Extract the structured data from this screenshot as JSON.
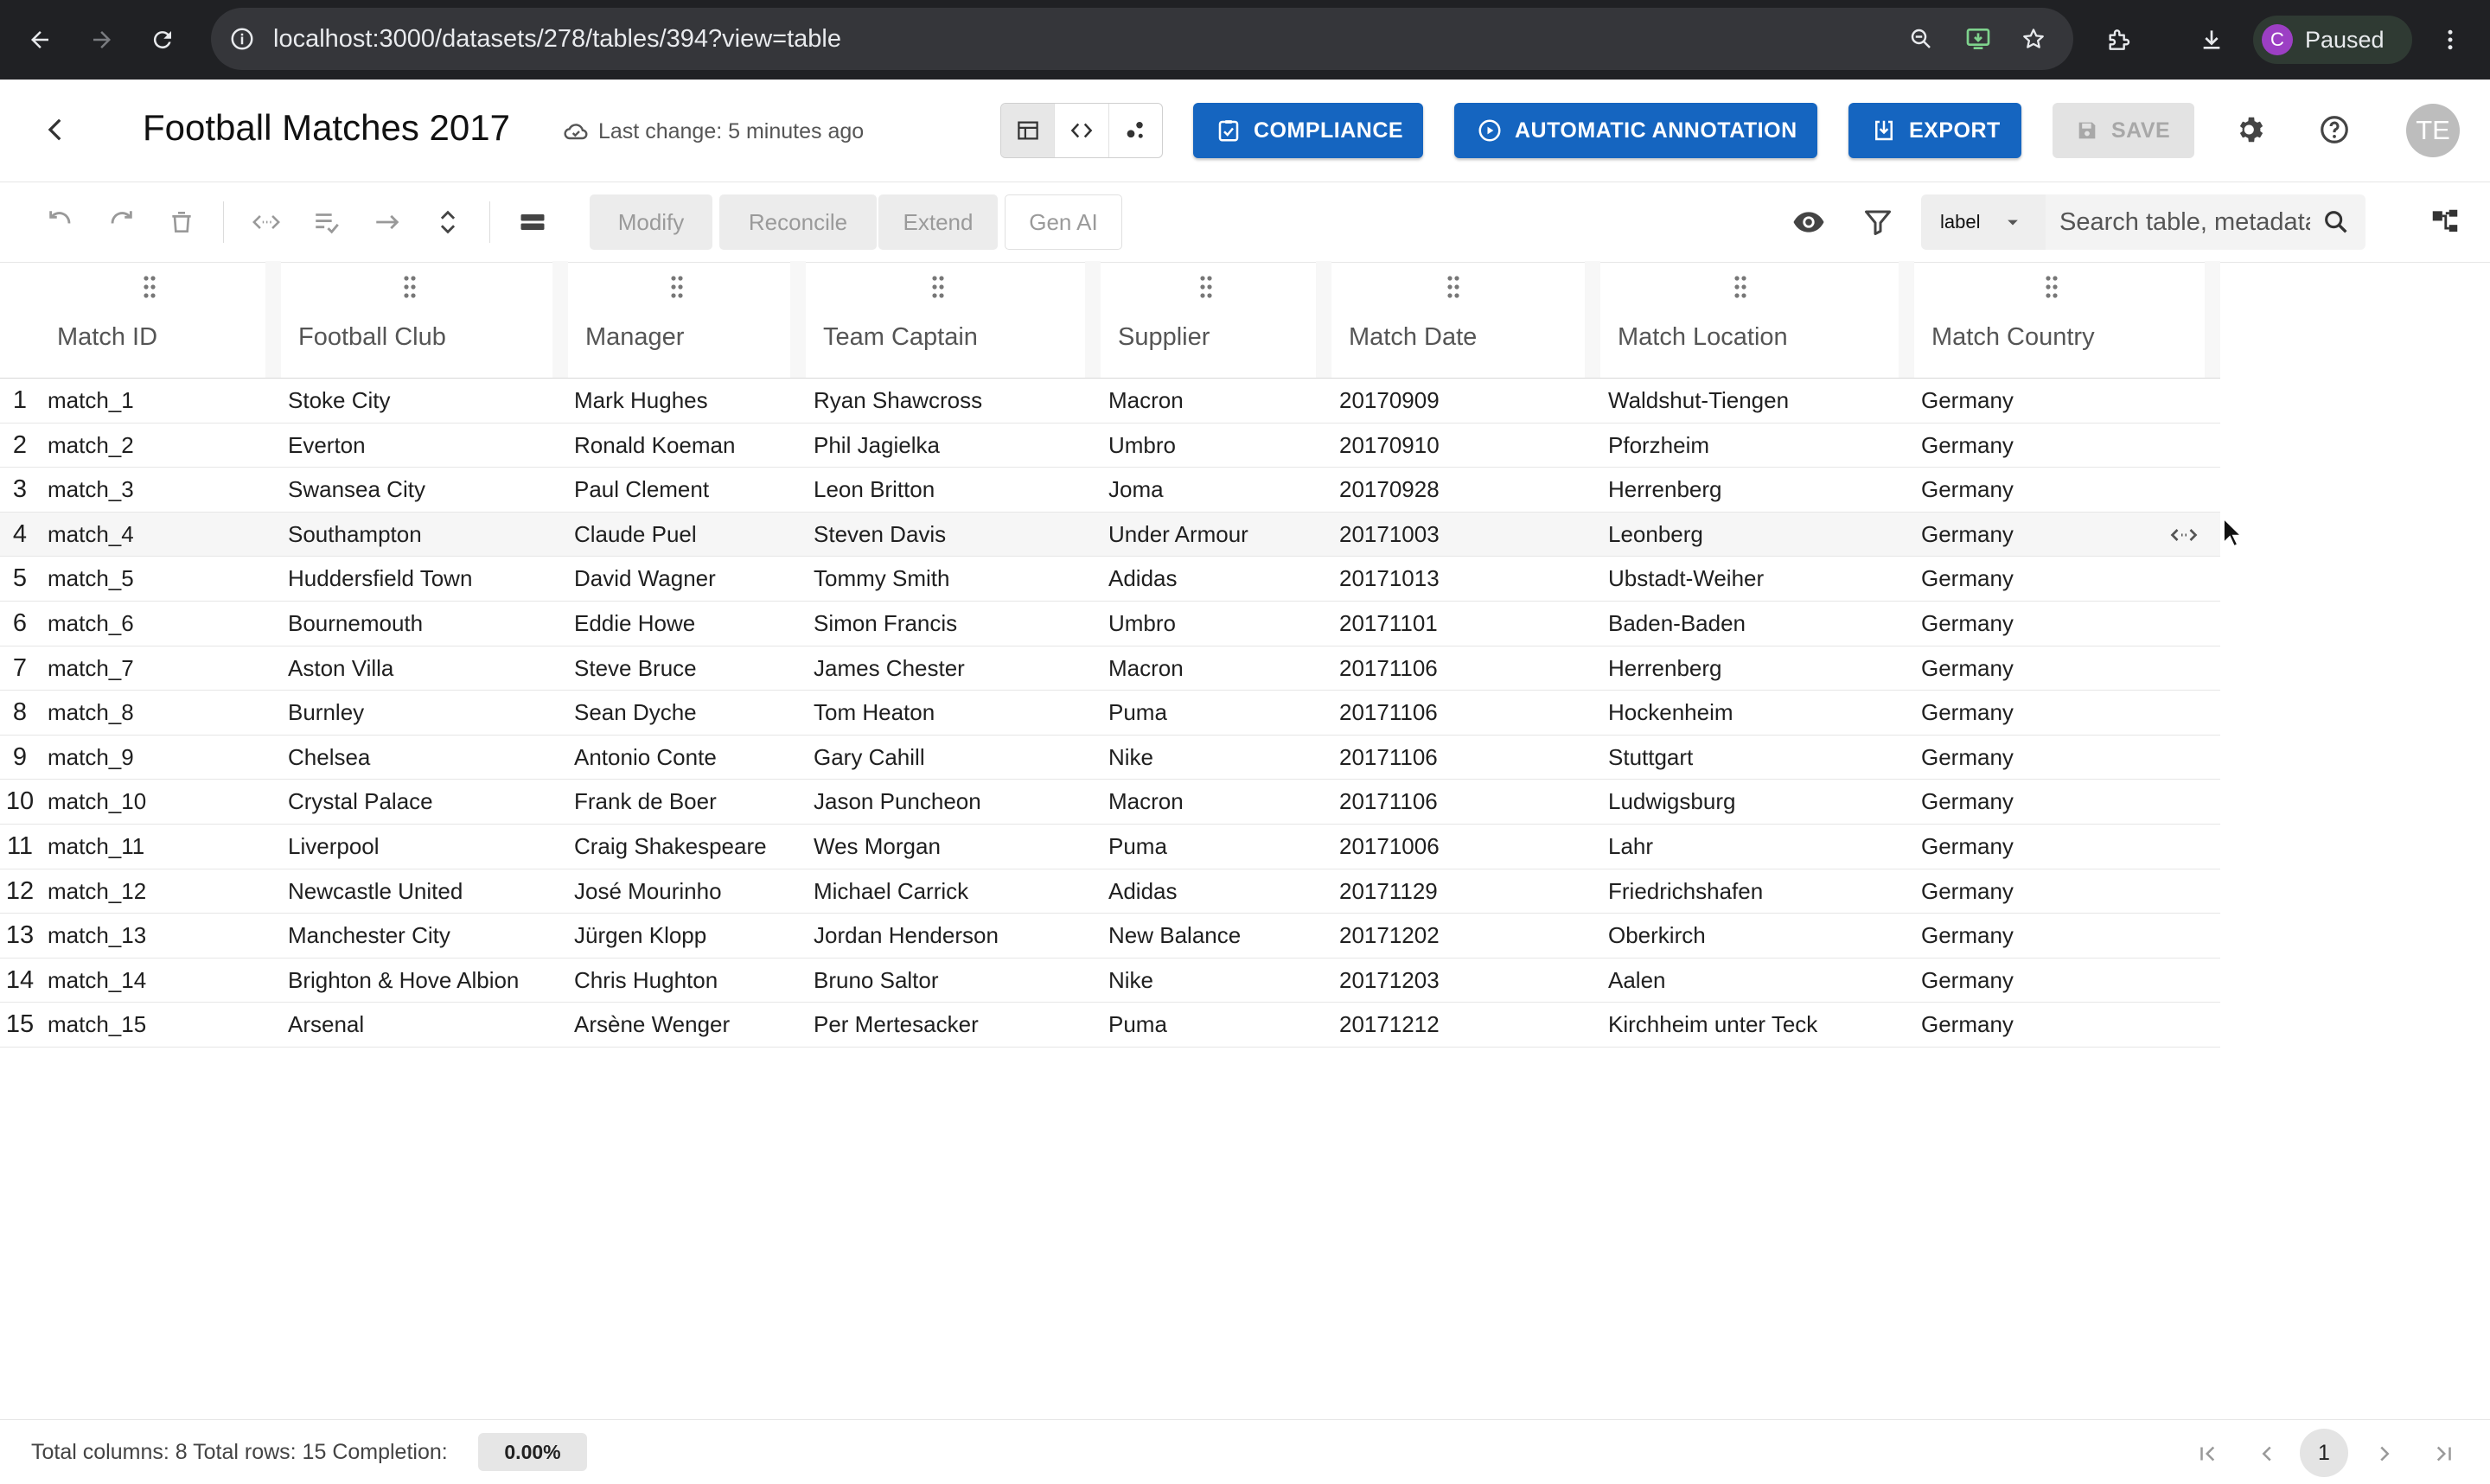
{
  "browser": {
    "url": "localhost:3000/datasets/278/tables/394?view=table",
    "profile_initial": "C",
    "profile_status": "Paused"
  },
  "header": {
    "title": "Football Matches 2017",
    "last_change": "Last change: 5 minutes ago",
    "compliance_label": "COMPLIANCE",
    "annotation_label": "AUTOMATIC ANNOTATION",
    "export_label": "EXPORT",
    "save_label": "SAVE",
    "user_initials": "TE",
    "accent_color": "#1565c0"
  },
  "toolbar": {
    "modify_label": "Modify",
    "reconcile_label": "Reconcile",
    "extend_label": "Extend",
    "genai_label": "Gen AI",
    "label_select": "label",
    "search_placeholder": "Search table, metadata..."
  },
  "table": {
    "columns": [
      "Match ID",
      "Football Club",
      "Manager",
      "Team Captain",
      "Supplier",
      "Match Date",
      "Match Location",
      "Match Country"
    ],
    "rows": [
      {
        "n": "1",
        "cells": [
          "match_1",
          "Stoke City",
          "Mark Hughes",
          "Ryan Shawcross",
          "Macron",
          "20170909",
          "Waldshut-Tiengen",
          "Germany"
        ]
      },
      {
        "n": "2",
        "cells": [
          "match_2",
          "Everton",
          "Ronald Koeman",
          "Phil Jagielka",
          "Umbro",
          "20170910",
          "Pforzheim",
          "Germany"
        ]
      },
      {
        "n": "3",
        "cells": [
          "match_3",
          "Swansea City",
          "Paul Clement",
          "Leon Britton",
          "Joma",
          "20170928",
          "Herrenberg",
          "Germany"
        ]
      },
      {
        "n": "4",
        "cells": [
          "match_4",
          "Southampton",
          "Claude Puel",
          "Steven Davis",
          "Under Armour",
          "20171003",
          "Leonberg",
          "Germany"
        ]
      },
      {
        "n": "5",
        "cells": [
          "match_5",
          "Huddersfield Town",
          "David Wagner",
          "Tommy Smith",
          "Adidas",
          "20171013",
          "Ubstadt-Weiher",
          "Germany"
        ]
      },
      {
        "n": "6",
        "cells": [
          "match_6",
          "Bournemouth",
          "Eddie Howe",
          "Simon Francis",
          "Umbro",
          "20171101",
          "Baden-Baden",
          "Germany"
        ]
      },
      {
        "n": "7",
        "cells": [
          "match_7",
          "Aston Villa",
          "Steve Bruce",
          "James Chester",
          "Macron",
          "20171106",
          "Herrenberg",
          "Germany"
        ]
      },
      {
        "n": "8",
        "cells": [
          "match_8",
          "Burnley",
          "Sean Dyche",
          "Tom Heaton",
          "Puma",
          "20171106",
          "Hockenheim",
          "Germany"
        ]
      },
      {
        "n": "9",
        "cells": [
          "match_9",
          "Chelsea",
          "Antonio Conte",
          "Gary Cahill",
          "Nike",
          "20171106",
          "Stuttgart",
          "Germany"
        ]
      },
      {
        "n": "10",
        "cells": [
          "match_10",
          "Crystal Palace",
          "Frank de Boer",
          "Jason Puncheon",
          "Macron",
          "20171106",
          "Ludwigsburg",
          "Germany"
        ]
      },
      {
        "n": "11",
        "cells": [
          "match_11",
          "Liverpool",
          "Craig Shakespeare",
          "Wes Morgan",
          "Puma",
          "20171006",
          "Lahr",
          "Germany"
        ]
      },
      {
        "n": "12",
        "cells": [
          "match_12",
          "Newcastle United",
          "José Mourinho",
          "Michael Carrick",
          "Adidas",
          "20171129",
          "Friedrichshafen",
          "Germany"
        ]
      },
      {
        "n": "13",
        "cells": [
          "match_13",
          "Manchester City",
          "Jürgen Klopp",
          "Jordan Henderson",
          "New Balance",
          "20171202",
          "Oberkirch",
          "Germany"
        ]
      },
      {
        "n": "14",
        "cells": [
          "match_14",
          "Brighton & Hove Albion",
          "Chris Hughton",
          "Bruno Saltor",
          "Nike",
          "20171203",
          "Aalen",
          "Germany"
        ]
      },
      {
        "n": "15",
        "cells": [
          "match_15",
          "Arsenal",
          "Arsène Wenger",
          "Per Mertesacker",
          "Puma",
          "20171212",
          "Kirchheim unter Teck",
          "Germany"
        ]
      }
    ]
  },
  "footer": {
    "stats": "Total columns: 8 Total rows: 15 Completion:",
    "completion": "0.00%",
    "current_page": "1"
  }
}
